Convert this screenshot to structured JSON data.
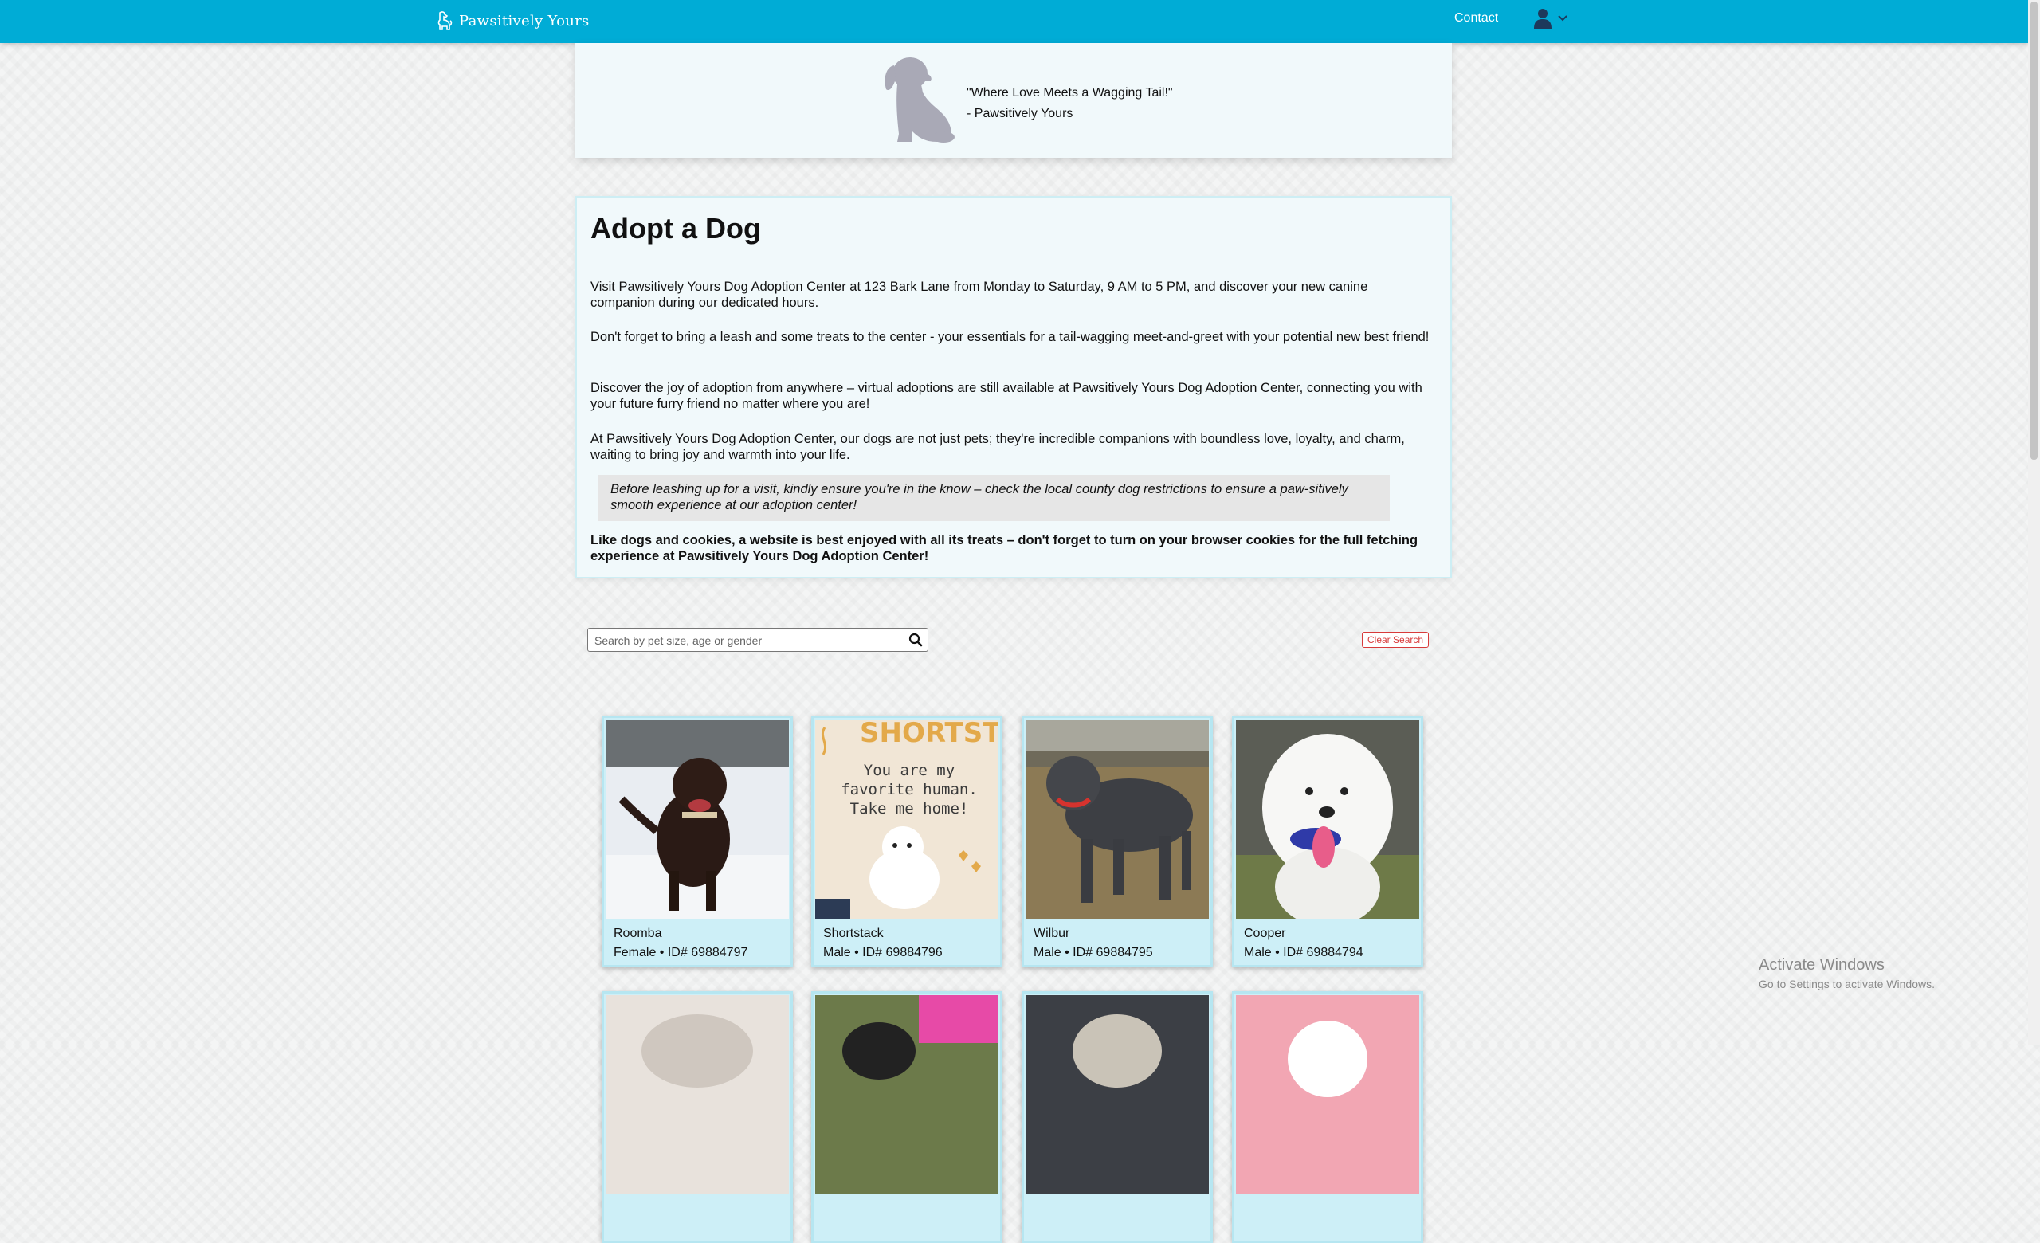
{
  "nav": {
    "brand": "Pawsitively Yours",
    "contact": "Contact"
  },
  "hero": {
    "quote": "\"Where Love Meets a Wagging Tail!\"",
    "attribution": "- Pawsitively Yours"
  },
  "adopt": {
    "title": "Adopt a Dog",
    "paragraphs": [
      "Visit Pawsitively Yours Dog Adoption Center at 123 Bark Lane from Monday to Saturday, 9 AM to 5 PM, and discover your new canine companion during our dedicated hours.",
      "Don't forget to bring a leash and some treats to the center - your essentials for a tail-wagging meet-and-greet with your potential new best friend!",
      "Discover the joy of adoption from anywhere – virtual adoptions are still available at Pawsitively Yours Dog Adoption Center, connecting you with your future furry friend no matter where you are!",
      "At Pawsitively Yours Dog Adoption Center, our dogs are not just pets; they're incredible companions with boundless love, loyalty, and charm, waiting to bring joy and warmth into your life."
    ],
    "note": "Before leashing up for a visit, kindly ensure you're in the know – check the local county dog restrictions to ensure a paw-sitively smooth experience at our adoption center!",
    "cookies": "Like dogs and cookies, a website is best enjoyed with all its treats – don't forget to turn on your browser cookies for the full fetching experience at Pawsitively Yours Dog Adoption Center!"
  },
  "search": {
    "placeholder": "Search by pet size, age or gender",
    "clear_label": "Clear Search"
  },
  "dogs": [
    {
      "name": "Roomba",
      "meta": "Female • ID# 69884797"
    },
    {
      "name": "Shortstack",
      "meta": "Male • ID# 69884796",
      "poster": [
        "SHORTSTA",
        "You are my",
        "favorite human.",
        "Take me home!"
      ]
    },
    {
      "name": "Wilbur",
      "meta": "Male • ID# 69884795"
    },
    {
      "name": "Cooper",
      "meta": "Male • ID# 69884794"
    }
  ],
  "os_watermark": {
    "line1": "Activate Windows",
    "line2": "Go to Settings to activate Windows."
  }
}
